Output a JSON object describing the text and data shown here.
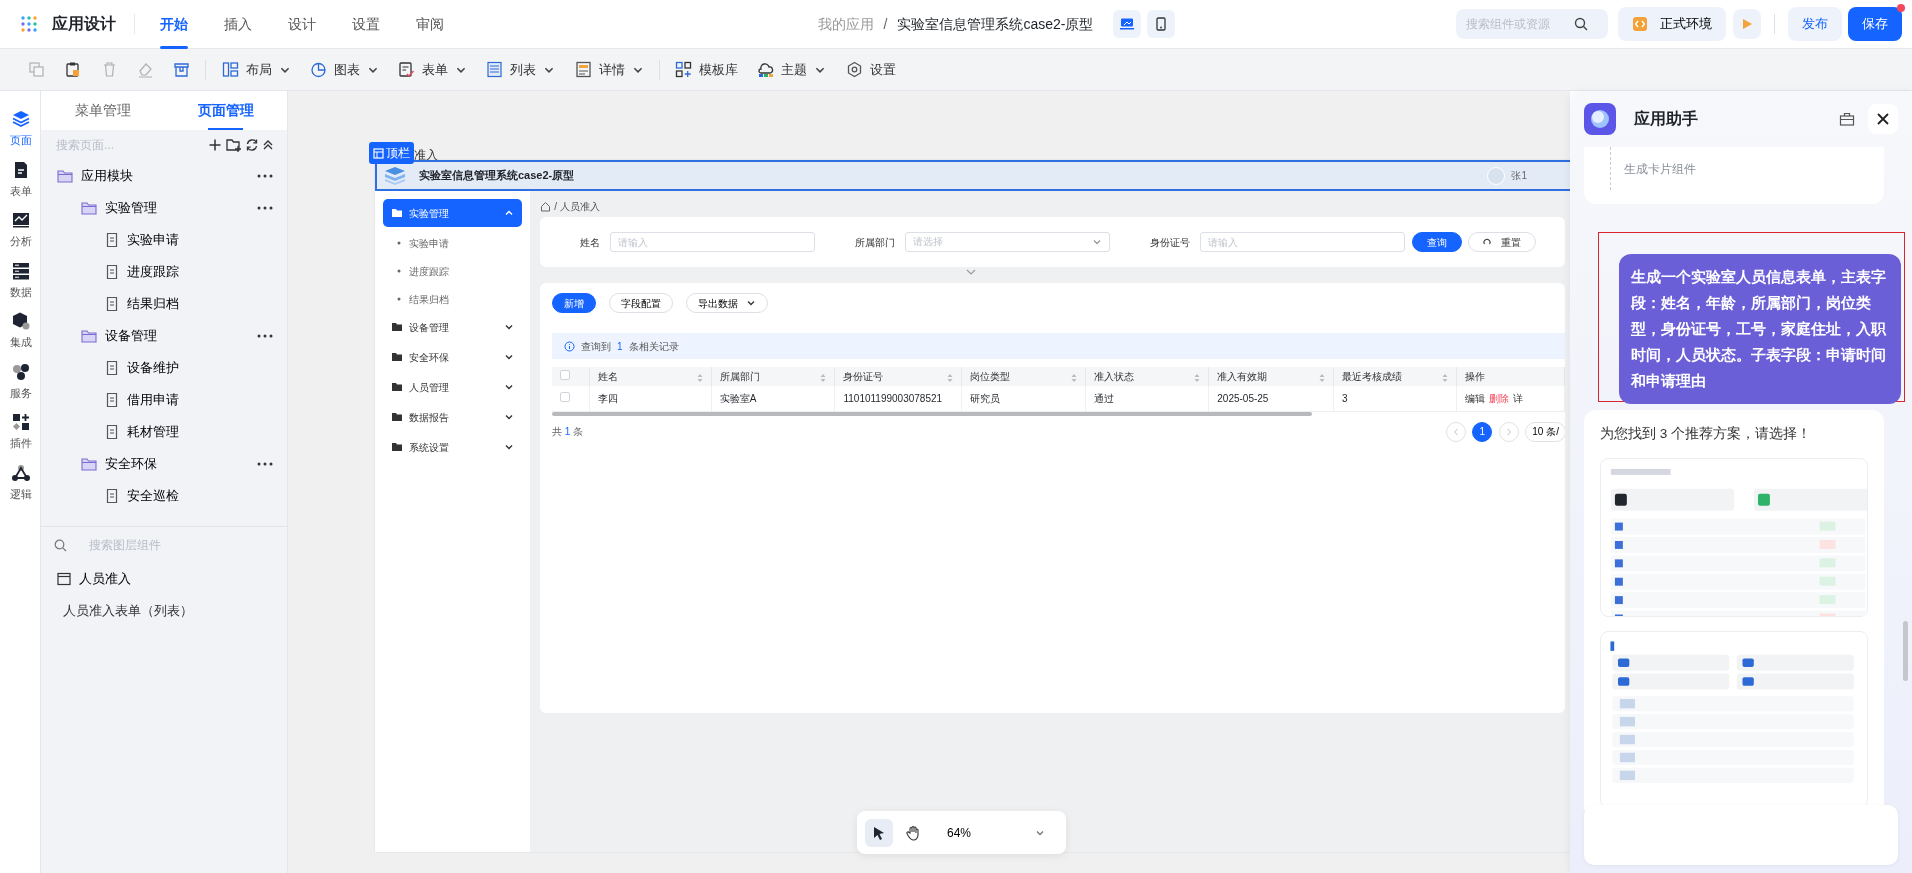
{
  "app_bar": {
    "title": "应用设计",
    "tabs": [
      {
        "label": "开始",
        "selected": true
      },
      {
        "label": "插入",
        "selected": false
      },
      {
        "label": "设计",
        "selected": false
      },
      {
        "label": "设置",
        "selected": false
      },
      {
        "label": "审阅",
        "selected": false
      }
    ],
    "breadcrumb": {
      "parent": "我的应用",
      "separator": "/",
      "current": "实验室信息管理系统case2-原型"
    },
    "devices": [
      {
        "kind": "desktop",
        "selected": true
      },
      {
        "kind": "tablet",
        "selected": false
      }
    ],
    "search": {
      "placeholder": "搜索组件或资源"
    },
    "environment": "正式环境",
    "buttons": [
      {
        "label": "发布",
        "kind": "secondary",
        "notify": false
      },
      {
        "label": "保存",
        "kind": "primary",
        "notify": true
      }
    ]
  },
  "toolbar": [
    {
      "kind": "copy",
      "disabled": true
    },
    {
      "kind": "paste",
      "disabled": false
    },
    {
      "kind": "delete",
      "disabled": true
    },
    {
      "kind": "erase",
      "disabled": true
    },
    {
      "kind": "store",
      "disabled": false
    },
    {
      "kind": "layout",
      "label": "布局",
      "dropdown": true
    },
    {
      "kind": "chart",
      "label": "图表",
      "dropdown": true
    },
    {
      "kind": "form",
      "label": "表单",
      "dropdown": true
    },
    {
      "kind": "list",
      "label": "列表",
      "dropdown": true
    },
    {
      "kind": "detail",
      "label": "详情",
      "dropdown": true
    },
    {
      "kind": "template",
      "label": "模板库",
      "dropdown": false
    },
    {
      "kind": "theme",
      "label": "主题",
      "dropdown": true
    },
    {
      "kind": "settings",
      "label": "设置",
      "dropdown": false
    }
  ],
  "rail": [
    {
      "label": "页面",
      "selected": true
    },
    {
      "label": "表单",
      "selected": false
    },
    {
      "label": "分析",
      "selected": false
    },
    {
      "label": "数据",
      "selected": false
    },
    {
      "label": "集成",
      "selected": false
    },
    {
      "label": "服务",
      "selected": false
    },
    {
      "label": "插件",
      "selected": false
    },
    {
      "label": "逻辑",
      "selected": false
    }
  ],
  "left_panel": {
    "tabs": [
      {
        "label": "菜单管理",
        "selected": false
      },
      {
        "label": "页面管理",
        "selected": true
      }
    ],
    "search": {
      "placeholder": "搜索页面..."
    },
    "tree": [
      {
        "kind": "folder",
        "label": "应用模块",
        "children": [
          {
            "kind": "folder",
            "label": "实验管理",
            "children": [
              {
                "kind": "page",
                "label": "实验申请"
              },
              {
                "kind": "page",
                "label": "进度跟踪"
              },
              {
                "kind": "page",
                "label": "结果归档"
              }
            ]
          },
          {
            "kind": "folder",
            "label": "设备管理",
            "children": [
              {
                "kind": "page",
                "label": "设备维护"
              },
              {
                "kind": "page",
                "label": "借用申请"
              },
              {
                "kind": "page",
                "label": "耗材管理"
              }
            ]
          },
          {
            "kind": "folder",
            "label": "安全环保",
            "children": [
              {
                "kind": "page",
                "label": "安全巡检"
              }
            ]
          }
        ]
      }
    ],
    "layer_search": {
      "placeholder": "搜索图层组件"
    },
    "layers": [
      {
        "kind": "page",
        "label": "人员准入",
        "children": [
          {
            "kind": "component",
            "label": "人员准入表单（列表）"
          }
        ]
      }
    ]
  },
  "canvas": {
    "frame_tag": "顶栏",
    "page_title": "准入",
    "app": {
      "title": "实验室信息管理系统case2-原型",
      "user": "张1",
      "menu": [
        {
          "label": "实验管理",
          "selected": true,
          "expanded": true,
          "children": [
            {
              "label": "实验申请"
            },
            {
              "label": "进度跟踪"
            },
            {
              "label": "结果归档"
            }
          ]
        },
        {
          "label": "设备管理",
          "selected": false,
          "expanded": false
        },
        {
          "label": "安全环保",
          "selected": false,
          "expanded": false
        },
        {
          "label": "人员管理",
          "selected": false,
          "expanded": false
        },
        {
          "label": "数据报告",
          "selected": false,
          "expanded": false
        },
        {
          "label": "系统设置",
          "selected": false,
          "expanded": false
        }
      ],
      "breadcrumb": "人员准入",
      "filters": [
        {
          "label": "姓名",
          "kind": "input",
          "placeholder": "请输入"
        },
        {
          "label": "所属部门",
          "kind": "select",
          "placeholder": "请选择"
        },
        {
          "label": "身份证号",
          "kind": "input",
          "placeholder": "请输入"
        }
      ],
      "query_button": "查询",
      "reset_button": "重置",
      "actions": [
        {
          "label": "新增",
          "kind": "primary"
        },
        {
          "label": "字段配置",
          "kind": "plain"
        },
        {
          "label": "导出数据",
          "kind": "dropdown"
        }
      ],
      "result": {
        "prefix": "查询到",
        "count": "1",
        "suffix": "条相关记录"
      },
      "table": {
        "header_checked": false,
        "columns": [
          {
            "label": "姓名",
            "sortable": true
          },
          {
            "label": "所属部门",
            "sortable": true
          },
          {
            "label": "身份证号",
            "sortable": true
          },
          {
            "label": "岗位类型",
            "sortable": true
          },
          {
            "label": "准入状态",
            "sortable": true
          },
          {
            "label": "准入有效期",
            "sortable": true
          },
          {
            "label": "最近考核成绩",
            "sortable": true
          },
          {
            "label": "操作",
            "sortable": false
          }
        ],
        "rows": [
          {
            "checked": false,
            "cells": [
              "李四",
              "实验室A",
              "110101199003078521",
              "研究员",
              "通过",
              "2025-05-25",
              "3"
            ],
            "actions": [
              {
                "label": "编辑",
                "kind": "normal"
              },
              {
                "label": "删除",
                "kind": "danger"
              },
              {
                "label": "详",
                "kind": "normal"
              }
            ]
          }
        ]
      },
      "total": {
        "prefix": "共",
        "count": "1",
        "suffix": "条"
      },
      "pages": [
        {
          "label": "1",
          "selected": true
        }
      ],
      "page_size": "10 条/"
    },
    "zoom": {
      "tools": [
        {
          "kind": "pointer",
          "selected": true
        },
        {
          "kind": "hand",
          "selected": false
        }
      ],
      "value": "64%"
    }
  },
  "assistant": {
    "title": "应用助手",
    "history_item": "生成卡片组件",
    "message": "生成一个实验室人员信息表单，主表字段：姓名，年龄，所属部门，岗位类型，身份证号，工号，家庭住址，入职时间，人员状态。子表字段：申请时间和申请理由",
    "highlighted": true,
    "reply": "为您找到 3 个推荐方案，请选择！"
  }
}
